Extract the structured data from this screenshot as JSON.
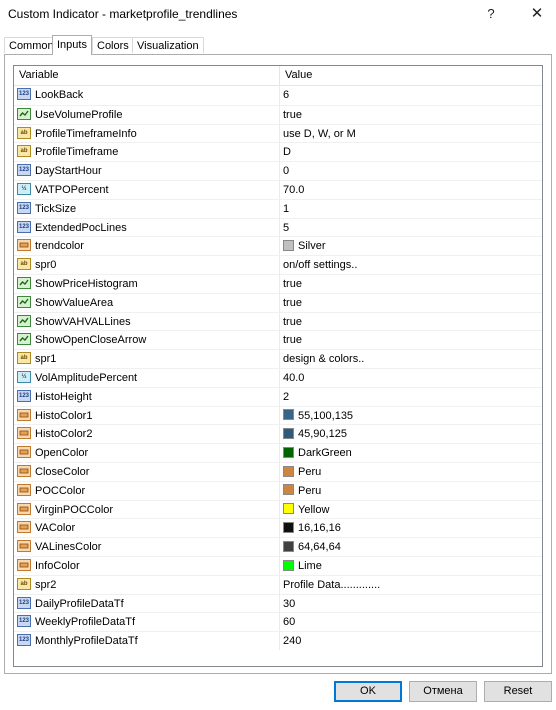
{
  "window": {
    "title": "Custom Indicator - marketprofile_trendlines",
    "help": "?",
    "close": "✕"
  },
  "tabs": [
    {
      "label": "Common",
      "active": false
    },
    {
      "label": "Inputs",
      "active": true
    },
    {
      "label": "Colors",
      "active": false
    },
    {
      "label": "Visualization",
      "active": false
    }
  ],
  "grid": {
    "headers": {
      "variable": "Variable",
      "value": "Value"
    },
    "rows": [
      {
        "type": "int",
        "name": "LookBack",
        "value": "6"
      },
      {
        "type": "bool",
        "name": "UseVolumeProfile",
        "value": "true"
      },
      {
        "type": "str",
        "name": "ProfileTimeframeInfo",
        "value": "use D, W, or M"
      },
      {
        "type": "str",
        "name": "ProfileTimeframe",
        "value": "D"
      },
      {
        "type": "int",
        "name": "DayStartHour",
        "value": "0"
      },
      {
        "type": "dbl",
        "name": "VATPOPercent",
        "value": "70.0"
      },
      {
        "type": "int",
        "name": "TickSize",
        "value": "1"
      },
      {
        "type": "int",
        "name": "ExtendedPocLines",
        "value": "5"
      },
      {
        "type": "clr",
        "name": "trendcolor",
        "value": "Silver",
        "swatch": "#c0c0c0"
      },
      {
        "type": "str",
        "name": "spr0",
        "value": "on/off settings.."
      },
      {
        "type": "bool",
        "name": "ShowPriceHistogram",
        "value": "true"
      },
      {
        "type": "bool",
        "name": "ShowValueArea",
        "value": "true"
      },
      {
        "type": "bool",
        "name": "ShowVAHVALLines",
        "value": "true"
      },
      {
        "type": "bool",
        "name": "ShowOpenCloseArrow",
        "value": "true"
      },
      {
        "type": "str",
        "name": "spr1",
        "value": "design & colors.."
      },
      {
        "type": "dbl",
        "name": "VolAmplitudePercent",
        "value": "40.0"
      },
      {
        "type": "int",
        "name": "HistoHeight",
        "value": "2"
      },
      {
        "type": "clr",
        "name": "HistoColor1",
        "value": "55,100,135",
        "swatch": "#376487"
      },
      {
        "type": "clr",
        "name": "HistoColor2",
        "value": "45,90,125",
        "swatch": "#2d5a7d"
      },
      {
        "type": "clr",
        "name": "OpenColor",
        "value": "DarkGreen",
        "swatch": "#006400"
      },
      {
        "type": "clr",
        "name": "CloseColor",
        "value": "Peru",
        "swatch": "#cd853f"
      },
      {
        "type": "clr",
        "name": "POCColor",
        "value": "Peru",
        "swatch": "#cd853f"
      },
      {
        "type": "clr",
        "name": "VirginPOCColor",
        "value": "Yellow",
        "swatch": "#ffff00"
      },
      {
        "type": "clr",
        "name": "VAColor",
        "value": "16,16,16",
        "swatch": "#101010"
      },
      {
        "type": "clr",
        "name": "VALinesColor",
        "value": "64,64,64",
        "swatch": "#404040"
      },
      {
        "type": "clr",
        "name": "InfoColor",
        "value": "Lime",
        "swatch": "#00ff00"
      },
      {
        "type": "str",
        "name": "spr2",
        "value": "Profile Data............."
      },
      {
        "type": "int",
        "name": "DailyProfileDataTf",
        "value": "30"
      },
      {
        "type": "int",
        "name": "WeeklyProfileDataTf",
        "value": "60"
      },
      {
        "type": "int",
        "name": "MonthlyProfileDataTf",
        "value": "240"
      }
    ]
  },
  "buttons": {
    "ok": "OK",
    "cancel": "Отмена",
    "reset": "Reset"
  }
}
